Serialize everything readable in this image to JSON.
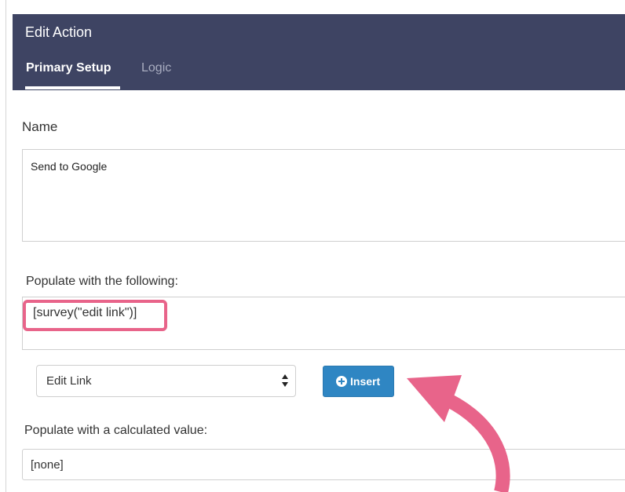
{
  "dialog": {
    "title": "Edit Action",
    "tabs": [
      {
        "label": "Primary Setup",
        "active": true
      },
      {
        "label": "Logic",
        "active": false
      }
    ]
  },
  "name_section": {
    "label": "Name",
    "value": "Send to Google"
  },
  "populate_section": {
    "label": "Populate with the following:",
    "value": "[survey(\"edit link\")]"
  },
  "merge_code": {
    "select_value": "Edit Link",
    "insert_label": "Insert",
    "insert_icon": "plus-circle-icon"
  },
  "calculated_section": {
    "label": "Populate with a calculated value:",
    "value": "[none]"
  },
  "colors": {
    "header_bg": "#3e4463",
    "highlight": "#e8648a",
    "button": "#2f86c3"
  }
}
